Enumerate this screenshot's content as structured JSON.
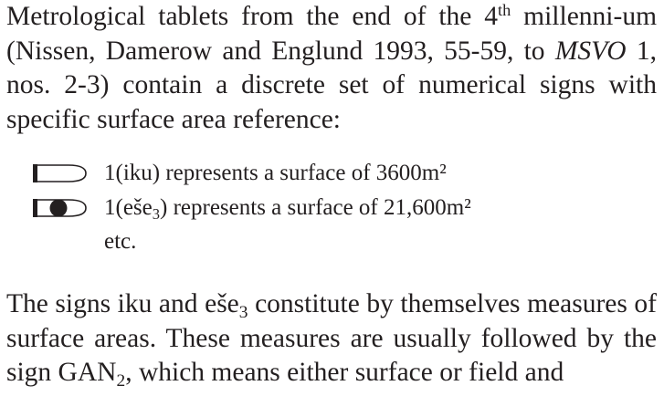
{
  "paragraph1": {
    "part1": "Metrological tablets from the end of the 4",
    "sup": "th",
    "part2": " millenni-um (Nissen, Damerow and Englund 1993, 55-59, to ",
    "italic": "MSVO",
    "part3": " 1, nos. 2-3) contain a discrete set of numerical signs with specific surface area reference:"
  },
  "list": [
    {
      "sign_icon": "iku-sign-icon",
      "text": "1(iku) represents a surface of 3600m²"
    },
    {
      "sign_icon": "ese3-sign-icon",
      "text_prefix": "1(eše",
      "text_sub": "3",
      "text_suffix": ") represents a surface of 21,600m²"
    },
    {
      "text": "etc."
    }
  ],
  "paragraph2": {
    "part1": "The signs iku and eše",
    "sub1": "3",
    "part2": " constitute by themselves measures of surface areas. These measures are usually followed by the sign GAN",
    "sub2": "2",
    "part3": ", which means either surface or field and"
  }
}
